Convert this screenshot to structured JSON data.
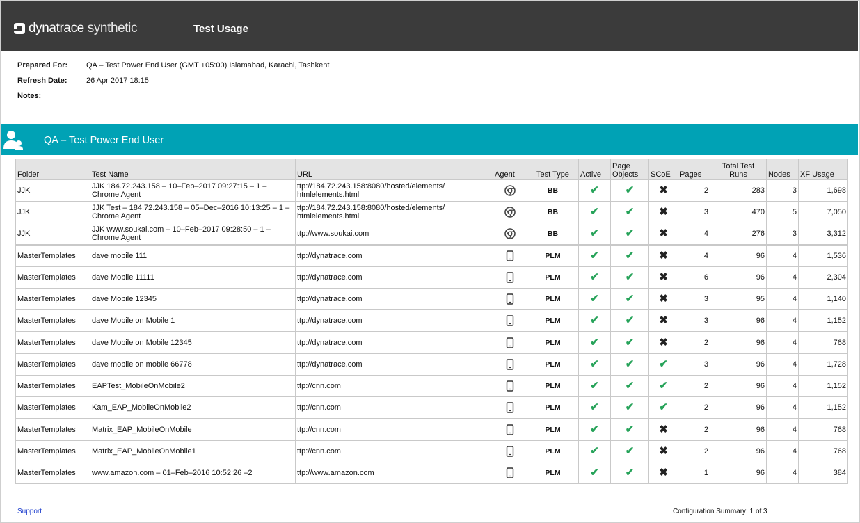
{
  "header": {
    "brand_bold": "dynatrace",
    "brand_light": " synthetic",
    "title": "Test Usage"
  },
  "meta": {
    "prepared_for_label": "Prepared For:",
    "prepared_for_value": "QA – Test Power End User  (GMT +05:00) Islamabad, Karachi, Tashkent",
    "refresh_label": "Refresh Date:",
    "refresh_value": "26 Apr 2017 18:15",
    "notes_label": "Notes:"
  },
  "banner": {
    "title": "QA – Test Power End User"
  },
  "table": {
    "columns": {
      "folder": "Folder",
      "test_name": "Test Name",
      "url": "URL",
      "agent": "Agent",
      "test_type": "Test Type",
      "active": "Active",
      "page_objects_1": "Page",
      "page_objects_2": "Objects",
      "scoe": "SCoE",
      "pages": "Pages",
      "total_runs_1": "Total Test",
      "total_runs_2": "Runs",
      "nodes": "Nodes",
      "xf_usage": "XF Usage"
    },
    "rows": [
      {
        "folder": "JJK",
        "test_name": "JJK 184.72.243.158 – 10–Feb–2017 09:27:15 – 1 – Chrome Agent",
        "url": "ttp://184.72.243.158:8080/hosted/elements/ htmlelements.html",
        "agent": "chrome-icon",
        "type": "BB",
        "active": true,
        "page_objects": true,
        "scoe": false,
        "pages": "2",
        "runs": "283",
        "nodes": "3",
        "xf": "1,698"
      },
      {
        "folder": "JJK",
        "test_name": "JJK Test – 184.72.243.158 – 05–Dec–2016 10:13:25 – 1 – Chrome Agent",
        "url": "ttp://184.72.243.158:8080/hosted/elements/ htmlelements.html",
        "agent": "chrome-icon",
        "type": "BB",
        "active": true,
        "page_objects": true,
        "scoe": false,
        "pages": "3",
        "runs": "470",
        "nodes": "5",
        "xf": "7,050"
      },
      {
        "folder": "JJK",
        "test_name": "JJK www.soukai.com – 10–Feb–2017 09:28:50 – 1 – Chrome Agent",
        "url": "ttp://www.soukai.com",
        "agent": "chrome-icon",
        "type": "BB",
        "active": true,
        "page_objects": true,
        "scoe": false,
        "pages": "4",
        "runs": "276",
        "nodes": "3",
        "xf": "3,312"
      },
      {
        "folder": "MasterTemplates",
        "test_name": "dave mobile 111",
        "url": "ttp://dynatrace.com",
        "agent": "mobile-icon",
        "type": "PLM",
        "active": true,
        "page_objects": true,
        "scoe": false,
        "pages": "4",
        "runs": "96",
        "nodes": "4",
        "xf": "1,536"
      },
      {
        "folder": "MasterTemplates",
        "test_name": "dave Mobile 11111",
        "url": "ttp://dynatrace.com",
        "agent": "mobile-icon",
        "type": "PLM",
        "active": true,
        "page_objects": true,
        "scoe": false,
        "pages": "6",
        "runs": "96",
        "nodes": "4",
        "xf": "2,304"
      },
      {
        "folder": "MasterTemplates",
        "test_name": "dave Mobile 12345",
        "url": "ttp://dynatrace.com",
        "agent": "mobile-icon",
        "type": "PLM",
        "active": true,
        "page_objects": true,
        "scoe": false,
        "pages": "3",
        "runs": "95",
        "nodes": "4",
        "xf": "1,140"
      },
      {
        "folder": "MasterTemplates",
        "test_name": "dave Mobile on Mobile 1",
        "url": "ttp://dynatrace.com",
        "agent": "mobile-icon",
        "type": "PLM",
        "active": true,
        "page_objects": true,
        "scoe": false,
        "pages": "3",
        "runs": "96",
        "nodes": "4",
        "xf": "1,152"
      },
      {
        "folder": "MasterTemplates",
        "test_name": "dave Mobile on Mobile 12345",
        "url": "ttp://dynatrace.com",
        "agent": "mobile-icon",
        "type": "PLM",
        "active": true,
        "page_objects": true,
        "scoe": false,
        "pages": "2",
        "runs": "96",
        "nodes": "4",
        "xf": "768"
      },
      {
        "folder": "MasterTemplates",
        "test_name": "dave mobile on mobile 66778",
        "url": "ttp://dynatrace.com",
        "agent": "mobile-icon",
        "type": "PLM",
        "active": true,
        "page_objects": true,
        "scoe": true,
        "pages": "3",
        "runs": "96",
        "nodes": "4",
        "xf": "1,728"
      },
      {
        "folder": "MasterTemplates",
        "test_name": "EAPTest_MobileOnMobile2",
        "url": "ttp://cnn.com",
        "agent": "mobile-icon",
        "type": "PLM",
        "active": true,
        "page_objects": true,
        "scoe": true,
        "pages": "2",
        "runs": "96",
        "nodes": "4",
        "xf": "1,152"
      },
      {
        "folder": "MasterTemplates",
        "test_name": "Kam_EAP_MobileOnMobile2",
        "url": "ttp://cnn.com",
        "agent": "mobile-icon",
        "type": "PLM",
        "active": true,
        "page_objects": true,
        "scoe": true,
        "pages": "2",
        "runs": "96",
        "nodes": "4",
        "xf": "1,152"
      },
      {
        "folder": "MasterTemplates",
        "test_name": "Matrix_EAP_MobileOnMobile",
        "url": "ttp://cnn.com",
        "agent": "mobile-icon",
        "type": "PLM",
        "active": true,
        "page_objects": true,
        "scoe": false,
        "pages": "2",
        "runs": "96",
        "nodes": "4",
        "xf": "768"
      },
      {
        "folder": "MasterTemplates",
        "test_name": "Matrix_EAP_MobileOnMobile1",
        "url": "ttp://cnn.com",
        "agent": "mobile-icon",
        "type": "PLM",
        "active": true,
        "page_objects": true,
        "scoe": false,
        "pages": "2",
        "runs": "96",
        "nodes": "4",
        "xf": "768"
      },
      {
        "folder": "MasterTemplates",
        "test_name": "www.amazon.com – 01–Feb–2016 10:52:26 –2",
        "url": "ttp://www.amazon.com",
        "agent": "mobile-icon",
        "type": "PLM",
        "active": true,
        "page_objects": true,
        "scoe": false,
        "pages": "1",
        "runs": "96",
        "nodes": "4",
        "xf": "384"
      }
    ]
  },
  "footer": {
    "support": "Support",
    "summary": "Configuration Summary: 1 of 3"
  },
  "colors": {
    "header_bg": "#3b3b3b",
    "banner_bg": "#00a2b5",
    "check": "#27a35a",
    "link": "#1a3bcc"
  }
}
